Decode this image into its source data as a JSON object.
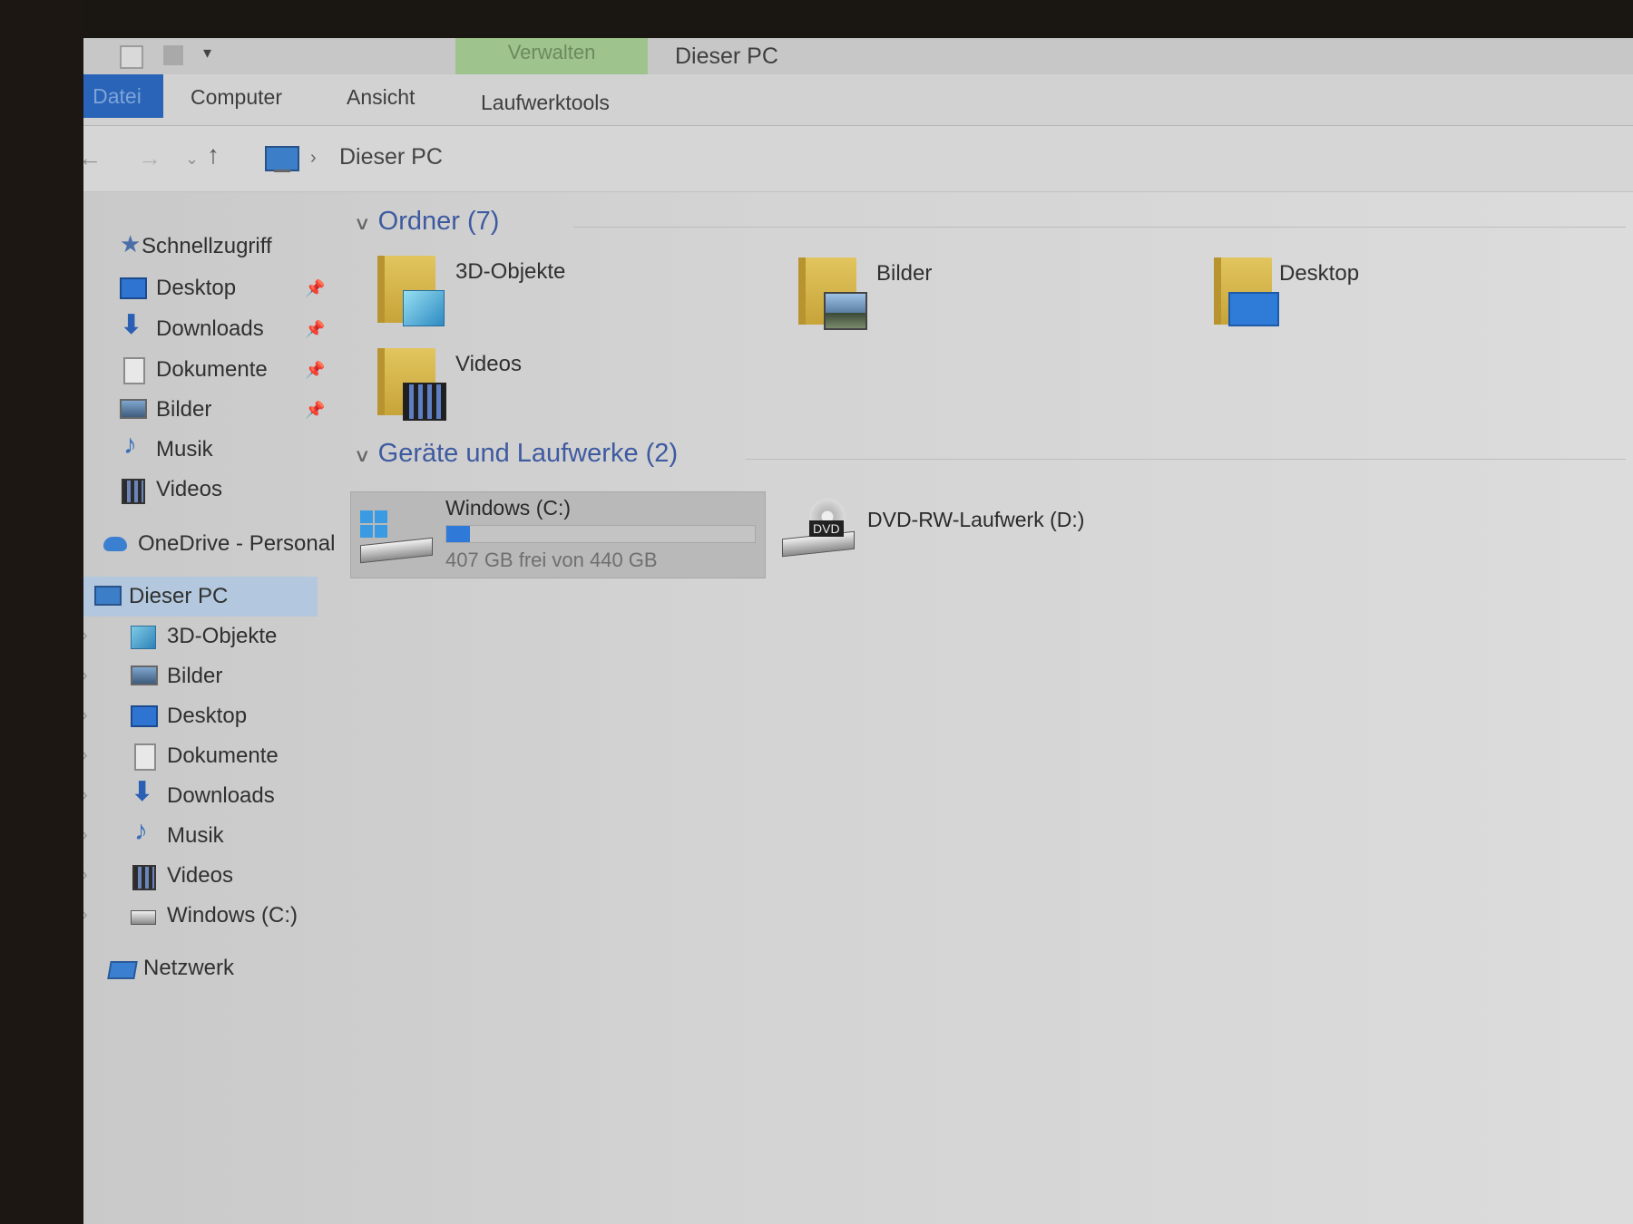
{
  "window": {
    "title": "Dieser PC",
    "contextual_tab_group": "Verwalten"
  },
  "quick_access_toolbar": {
    "icons": [
      "properties-icon",
      "new-folder-icon",
      "customize-dropdown-icon"
    ]
  },
  "ribbon": {
    "tabs": [
      "Datei",
      "Computer",
      "Ansicht",
      "Laufwerktools"
    ]
  },
  "address_bar": {
    "location_icon": "this-pc-icon",
    "separator": "›",
    "path": "Dieser PC"
  },
  "nav_glyphs": {
    "back": "←",
    "forward": "→",
    "recent": "⌄",
    "up": "↑",
    "pin": "📌",
    "chevron": "›",
    "star": "★",
    "download": "⬇",
    "music": "♪"
  },
  "navigation_pane": {
    "quick_access": {
      "label": "Schnellzugriff",
      "items": [
        {
          "label": "Desktop",
          "icon": "desktop-icon",
          "pinned": true
        },
        {
          "label": "Downloads",
          "icon": "downloads-icon",
          "pinned": true
        },
        {
          "label": "Dokumente",
          "icon": "documents-icon",
          "pinned": true
        },
        {
          "label": "Bilder",
          "icon": "pictures-icon",
          "pinned": true
        },
        {
          "label": "Musik",
          "icon": "music-icon",
          "pinned": false
        },
        {
          "label": "Videos",
          "icon": "videos-icon",
          "pinned": false
        }
      ]
    },
    "onedrive": {
      "label": "OneDrive - Personal"
    },
    "this_pc": {
      "label": "Dieser PC",
      "selected": true,
      "children": [
        {
          "label": "3D-Objekte",
          "icon": "3d-objects-icon"
        },
        {
          "label": "Bilder",
          "icon": "pictures-icon"
        },
        {
          "label": "Desktop",
          "icon": "desktop-icon"
        },
        {
          "label": "Dokumente",
          "icon": "documents-icon"
        },
        {
          "label": "Downloads",
          "icon": "downloads-icon"
        },
        {
          "label": "Musik",
          "icon": "music-icon"
        },
        {
          "label": "Videos",
          "icon": "videos-icon"
        },
        {
          "label": "Windows (C:)",
          "icon": "drive-icon"
        }
      ]
    },
    "network": {
      "label": "Netzwerk"
    }
  },
  "content": {
    "folders_group": {
      "header": "Ordner (7)",
      "items": [
        {
          "label": "3D-Objekte",
          "icon": "3d-objects-folder-icon"
        },
        {
          "label": "Bilder",
          "icon": "pictures-folder-icon"
        },
        {
          "label": "Desktop",
          "icon": "desktop-folder-icon"
        },
        {
          "label": "Videos",
          "icon": "videos-folder-icon"
        }
      ]
    },
    "devices_group": {
      "header": "Geräte und Laufwerke (2)",
      "drives": [
        {
          "label": "Windows (C:)",
          "icon": "windows-drive-icon",
          "space_text": "407 GB frei von 440 GB",
          "used_fraction": 0.075,
          "bar_color": "#2f7ad8",
          "selected": true
        },
        {
          "label": "DVD-RW-Laufwerk (D:)",
          "icon": "dvd-drive-icon",
          "badge": "DVD"
        }
      ]
    }
  },
  "colors": {
    "accent": "#2a64b8",
    "group_header": "#3e5aa0",
    "contextual_tab": "#9fc38d",
    "selection": "#b3c8de"
  }
}
